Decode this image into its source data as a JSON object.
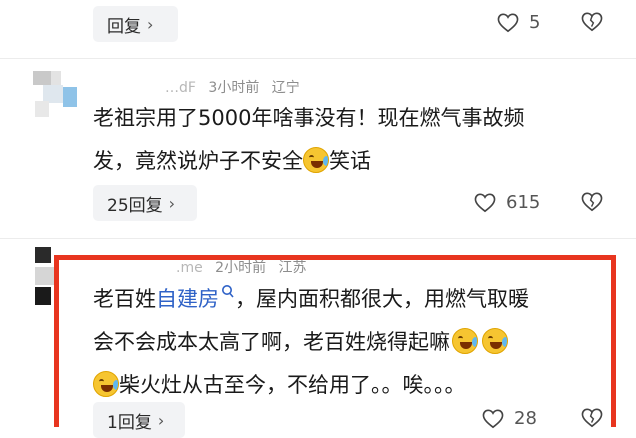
{
  "comments": [
    {
      "reply_label": "回复",
      "like_count": "5",
      "reply_chevron": "›"
    },
    {
      "username": "…dF",
      "time": "3小时前",
      "location": "辽宁",
      "text_line1": "老祖宗用了5000年啥事没有！现在燃气事故频",
      "text_line2_a": "发，竟然说炉子不安全",
      "text_line2_b": "笑话",
      "reply_label": "25回复",
      "reply_chevron": "›",
      "like_count": "615"
    },
    {
      "username": ".me",
      "time": "2小时前",
      "location": "江苏",
      "line1_a": "老百姓",
      "line1_link": "自建房",
      "line1_b": "，屋内面积都很大，用燃气取暖",
      "line2": "会不会成本太高了啊，老百姓烧得起嘛",
      "line3": "柴火灶从古至今，不给用了。。唉。。。",
      "reply_label": "1回复",
      "reply_chevron": "›",
      "like_count": "28"
    }
  ],
  "icons": {
    "like": "heart-outline-icon",
    "dislike": "broken-heart-icon",
    "search": "search-icon",
    "emoji": "laughing-crying-emoji-icon"
  },
  "colors": {
    "highlight_border": "#e8351f",
    "link": "#2f62c7"
  }
}
